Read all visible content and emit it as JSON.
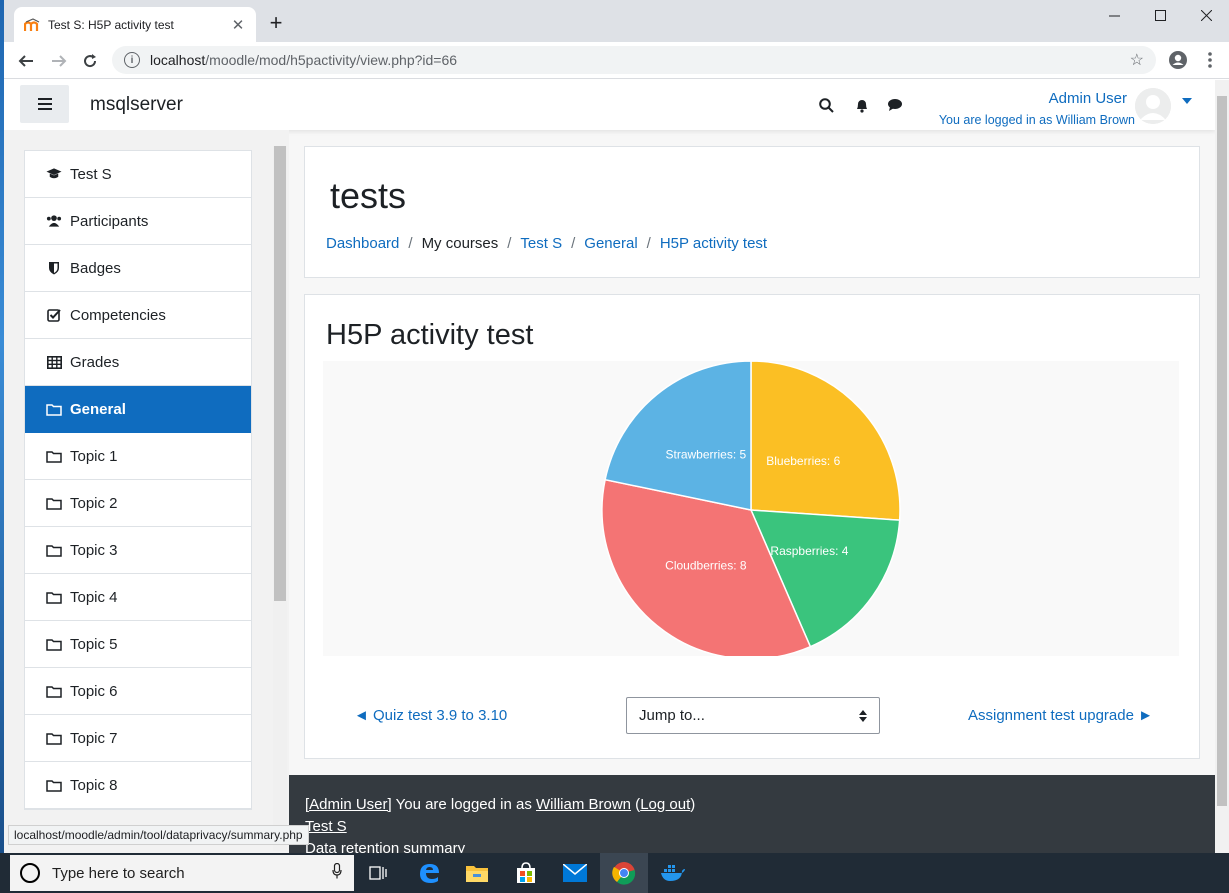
{
  "browser": {
    "tab_title": "Test S: H5P activity test",
    "tab_close": "✕",
    "new_tab": "+",
    "url_host": "localhost",
    "url_path": "/moodle/mod/h5pactivity/view.php?id=66",
    "status_url": "localhost/moodle/admin/tool/dataprivacy/summary.php"
  },
  "navbar": {
    "site_name": "msqlserver",
    "user_name": "Admin User",
    "logged_in_as": "You are logged in as William Brown"
  },
  "drawer": {
    "items": [
      {
        "label": "Test S",
        "icon": "graduation-cap-icon"
      },
      {
        "label": "Participants",
        "icon": "users-icon"
      },
      {
        "label": "Badges",
        "icon": "shield-icon"
      },
      {
        "label": "Competencies",
        "icon": "checkbox-icon"
      },
      {
        "label": "Grades",
        "icon": "table-icon"
      },
      {
        "label": "General",
        "icon": "folder-icon",
        "active": true
      },
      {
        "label": "Topic 1",
        "icon": "folder-icon"
      },
      {
        "label": "Topic 2",
        "icon": "folder-icon"
      },
      {
        "label": "Topic 3",
        "icon": "folder-icon"
      },
      {
        "label": "Topic 4",
        "icon": "folder-icon"
      },
      {
        "label": "Topic 5",
        "icon": "folder-icon"
      },
      {
        "label": "Topic 6",
        "icon": "folder-icon"
      },
      {
        "label": "Topic 7",
        "icon": "folder-icon"
      },
      {
        "label": "Topic 8",
        "icon": "folder-icon"
      }
    ]
  },
  "header": {
    "title": "tests",
    "breadcrumb": {
      "dashboard": "Dashboard",
      "my_courses": "My courses",
      "course": "Test S",
      "section": "General",
      "activity": "H5P activity test"
    }
  },
  "activity": {
    "title": "H5P activity test",
    "prev_link": "◄ Quiz test 3.9 to 3.10",
    "next_link": "Assignment test upgrade ►",
    "jump_to": "Jump to..."
  },
  "chart_data": {
    "type": "pie",
    "slices": [
      {
        "label": "Blueberries",
        "value": 6,
        "color": "#fbbf24"
      },
      {
        "label": "Raspberries",
        "value": 4,
        "color": "#3ac47d"
      },
      {
        "label": "Cloudberries",
        "value": 8,
        "color": "#f47474"
      },
      {
        "label": "Strawberries",
        "value": 5,
        "color": "#5cb3e4"
      }
    ]
  },
  "footer": {
    "admin_user": "[Admin User]",
    "logged_in_text": " You are logged in as ",
    "william": "William Brown",
    "logout_open": " (",
    "logout": "Log out",
    "logout_close": ")",
    "course_link": "Test S",
    "data_retention": "Data retention summary"
  },
  "taskbar": {
    "search_placeholder": "Type here to search"
  },
  "colors": {
    "accent": "#0f6cbf",
    "footer_bg": "#343a40"
  }
}
